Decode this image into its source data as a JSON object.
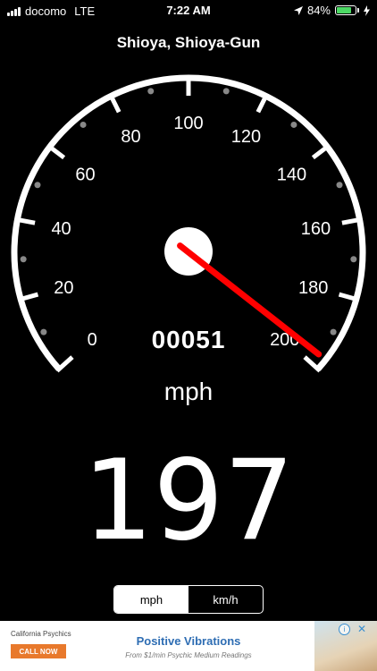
{
  "status": {
    "carrier": "docomo",
    "network": "LTE",
    "time": "7:22 AM",
    "battery": "84%",
    "battery_level": 0.84,
    "colors": {
      "battery": "#4cd964"
    }
  },
  "location": "Shioya, Shioya-Gun",
  "gauge": {
    "min": 0,
    "max": 200,
    "labels": [
      "0",
      "20",
      "40",
      "60",
      "80",
      "100",
      "120",
      "140",
      "160",
      "180",
      "200"
    ],
    "needle_value": 197,
    "colors": {
      "needle": "#ff0000",
      "dial": "#ffffff",
      "minor_dot": "#888888"
    }
  },
  "odometer": "00051",
  "unit": "mph",
  "speed": "197",
  "units_toggle": {
    "options": [
      "mph",
      "km/h"
    ],
    "selected": "mph"
  },
  "ad": {
    "brand": "California Psychics",
    "cta": "CALL NOW",
    "title": "Positive Vibrations",
    "subtitle": "From $1/min Psychic Medium Readings",
    "info_icon": "info-icon",
    "close_icon": "close-icon",
    "colors": {
      "title": "#2e6db3",
      "cta": "#e8792c"
    }
  }
}
